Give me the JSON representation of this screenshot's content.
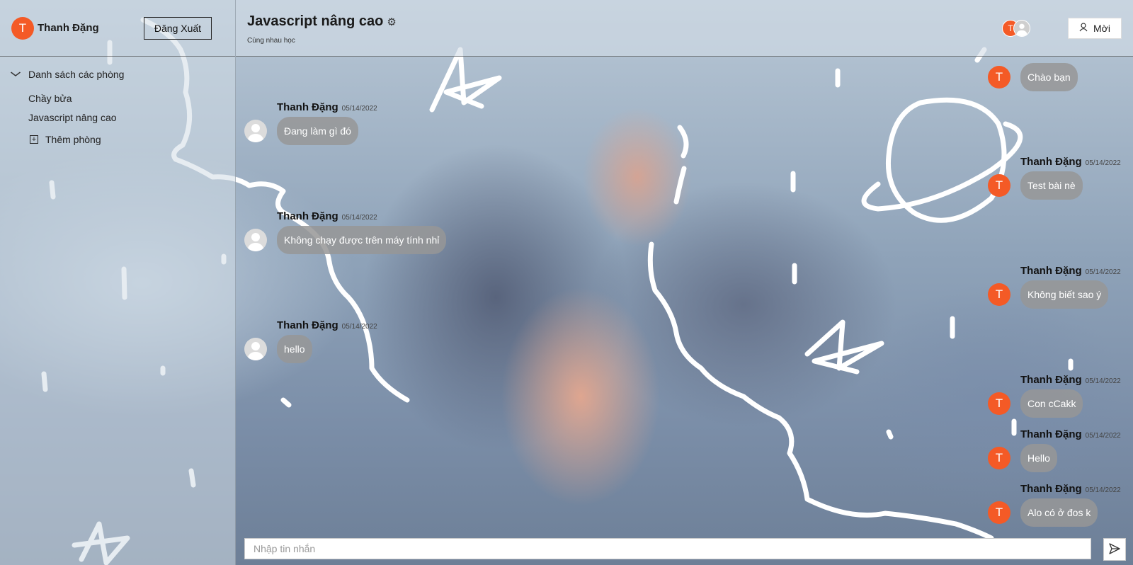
{
  "user": {
    "name": "Thanh Đặng",
    "avatar_letter": "T"
  },
  "sidebar": {
    "logout_label": "Đăng Xuất",
    "rooms_heading": "Danh sách các phòng",
    "rooms": [
      "Chầy bửa",
      "Javascript nâng cao"
    ],
    "add_room_label": "Thêm phòng"
  },
  "room": {
    "title": "Javascript nâng cao",
    "description": "Cùng nhau học",
    "invite_label": "Mời"
  },
  "messages_left": [
    {
      "name": "Thanh Đặng",
      "date": "05/14/2022",
      "text": "Đang làm gì đó"
    },
    {
      "name": "Thanh Đặng",
      "date": "05/14/2022",
      "text": "Không chạy được trên máy tính nhỉ"
    },
    {
      "name": "Thanh Đặng",
      "date": "05/14/2022",
      "text": "hello"
    }
  ],
  "messages_right": [
    {
      "name": "",
      "date": "",
      "text": "Chào bạn"
    },
    {
      "name": "Thanh Đặng",
      "date": "05/14/2022",
      "text": "Test bài nè"
    },
    {
      "name": "Thanh Đặng",
      "date": "05/14/2022",
      "text": "Không biết sao ý"
    },
    {
      "name": "Thanh Đặng",
      "date": "05/14/2022",
      "text": "Con cCakk"
    },
    {
      "name": "Thanh Đặng",
      "date": "05/14/2022",
      "text": "Hello"
    },
    {
      "name": "Thanh Đặng",
      "date": "05/14/2022",
      "text": "Alo có ở đos k"
    }
  ],
  "composer": {
    "placeholder": "Nhập tin nhắn"
  },
  "icons": {
    "room_settings": "gear-icon",
    "invite": "user-icon",
    "send": "send-icon",
    "expand": "chevron-down-icon",
    "add_room": "plus-square-icon"
  },
  "colors": {
    "avatar": "#f45a26",
    "bubble": "#969696"
  }
}
